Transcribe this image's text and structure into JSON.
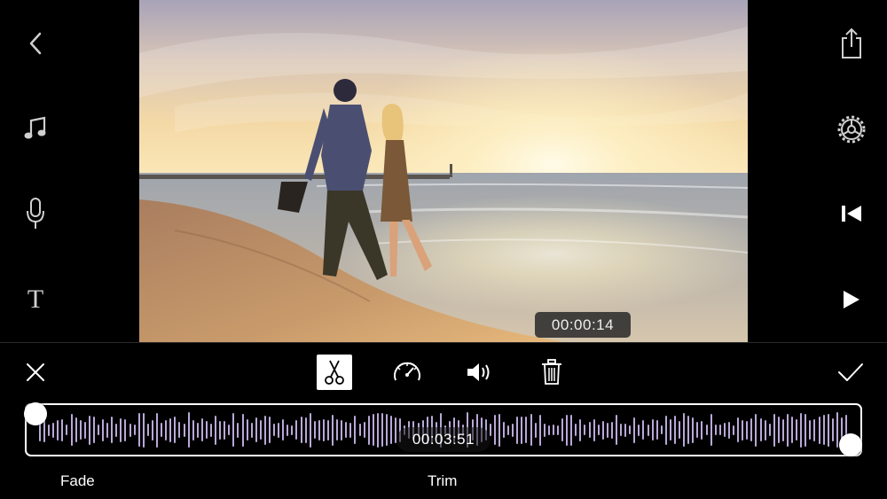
{
  "left_toolbar": {
    "icons": [
      "back-chevron-icon",
      "music-note-icon",
      "microphone-icon",
      "text-icon"
    ],
    "text_tool_glyph": "T"
  },
  "right_toolbar": {
    "icons": [
      "share-icon",
      "settings-gear-icon",
      "skip-to-start-icon",
      "play-icon"
    ]
  },
  "preview": {
    "current_time": "00:00:14"
  },
  "edit_toolbar": {
    "icons": [
      "close-icon",
      "scissors-icon",
      "speed-gauge-icon",
      "volume-icon",
      "trash-icon",
      "checkmark-icon"
    ],
    "active_tool": "scissors-icon"
  },
  "timeline": {
    "clip_duration": "00:03:51",
    "waveform_color": "#b9a9d8"
  },
  "bottom_tabs": {
    "fade_label": "Fade",
    "trim_label": "Trim"
  },
  "colors": {
    "background": "#000000",
    "icon_gray": "#cfcfcf",
    "handle": "#ffffff"
  }
}
